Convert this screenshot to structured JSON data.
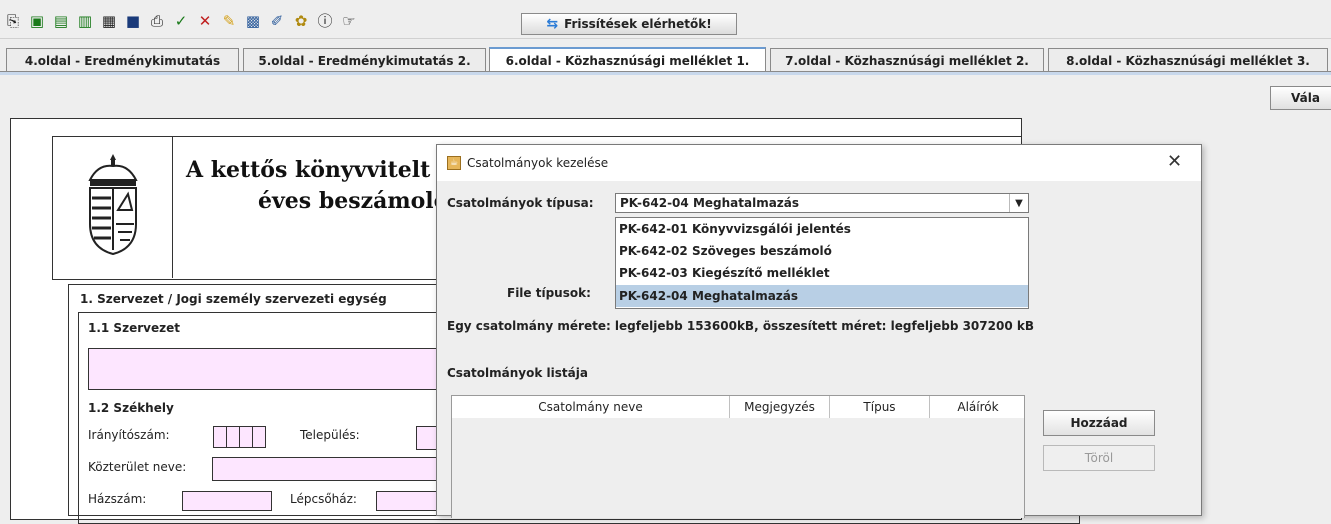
{
  "toolbar": {
    "icons": [
      "copy-icon",
      "save-icon",
      "save-as-icon",
      "save-close-icon",
      "document-icon",
      "book-icon",
      "print-icon",
      "check-icon",
      "delete-icon",
      "edit-icon",
      "calculator-icon",
      "tools-icon",
      "key-icon",
      "info-icon",
      "pointer-icon"
    ],
    "update_button": "Frissítések elérhetők!"
  },
  "tabs": [
    {
      "label": "4.oldal - Eredménykimutatás"
    },
    {
      "label": "5.oldal - Eredménykimutatás 2."
    },
    {
      "label": "6.oldal - Közhasznúsági melléklet 1."
    },
    {
      "label": "7.oldal - Közhasznúsági melléklet 2."
    },
    {
      "label": "8.oldal - Közhasznúsági melléklet 3."
    }
  ],
  "side_button": "Vála",
  "form": {
    "title": "A kettős könyvvitelt ve",
    "subtitle": "éves beszámoló",
    "section1": "1. Szervezet / Jogi személy szervezeti egység",
    "section1_1": "1.1 Szervezet",
    "section1_2": "1.2 Székhely",
    "zip_label": "Irányítószám:",
    "city_label": "Település:",
    "street_label": "Közterület neve:",
    "house_label": "Házszám:",
    "stair_label": "Lépcsőház:"
  },
  "dialog": {
    "title": "Csatolmányok kezelése",
    "type_label": "Csatolmányok típusa:",
    "selected_type": "PK-642-04 Meghatalmazás",
    "options": [
      "PK-642-01 Könyvvizsgálói jelentés",
      "PK-642-02 Szöveges beszámoló",
      "PK-642-03 Kiegészítő melléklet",
      "PK-642-04 Meghatalmazás"
    ],
    "file_types_label": "File típusok:",
    "size_info": "Egy csatolmány mérete: legfeljebb 153600kB, összesített méret: legfeljebb 307200 kB",
    "list_label": "Csatolmányok listája",
    "columns": [
      "Csatolmány neve",
      "Megjegyzés",
      "Típus",
      "Aláírók"
    ],
    "add_button": "Hozzáad",
    "delete_button": "Töröl"
  },
  "colors": {
    "tab_active_accent": "#6b9bd1",
    "field_fill": "#fde6ff",
    "dropdown_selected": "#b8cfe5"
  }
}
